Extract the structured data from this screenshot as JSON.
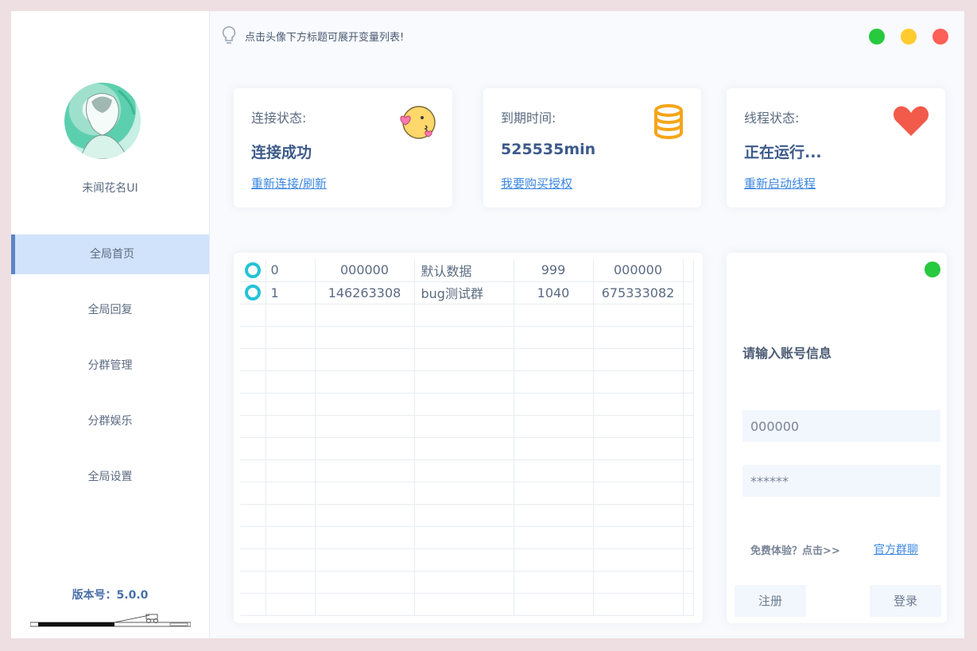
{
  "sidebar": {
    "app_name": "未闻花名UI",
    "nav": [
      "全局首页",
      "全局回复",
      "分群管理",
      "分群娱乐",
      "全局设置"
    ],
    "version": "版本号：5.0.0"
  },
  "topbar": {
    "tip": "点击头像下方标题可展开变量列表!",
    "colors": {
      "green": "#27c93f",
      "yellow": "#ffcb2f",
      "red": "#fe5f57"
    }
  },
  "cards": [
    {
      "label": "连接状态:",
      "value": "连接成功",
      "link": "重新连接/刷新",
      "icon": "kiss-emoji-icon"
    },
    {
      "label": "到期时间:",
      "value": "525535min",
      "link": "我要购买授权",
      "icon": "database-icon"
    },
    {
      "label": "线程状态:",
      "value": "正在运行...",
      "link": "重新启动线程",
      "icon": "heart-icon"
    }
  ],
  "table": {
    "rows": [
      [
        "0",
        "000000",
        "默认数据",
        "999",
        "000000"
      ],
      [
        "1",
        "146263308",
        "bug测试群",
        "1040",
        "675333082"
      ]
    ]
  },
  "login": {
    "title": "请输入账号信息",
    "account_value": "000000",
    "password_placeholder": "******",
    "free_text": "免费体验？点击>>",
    "group_link": "官方群聊",
    "register": "注册",
    "login": "登录"
  }
}
